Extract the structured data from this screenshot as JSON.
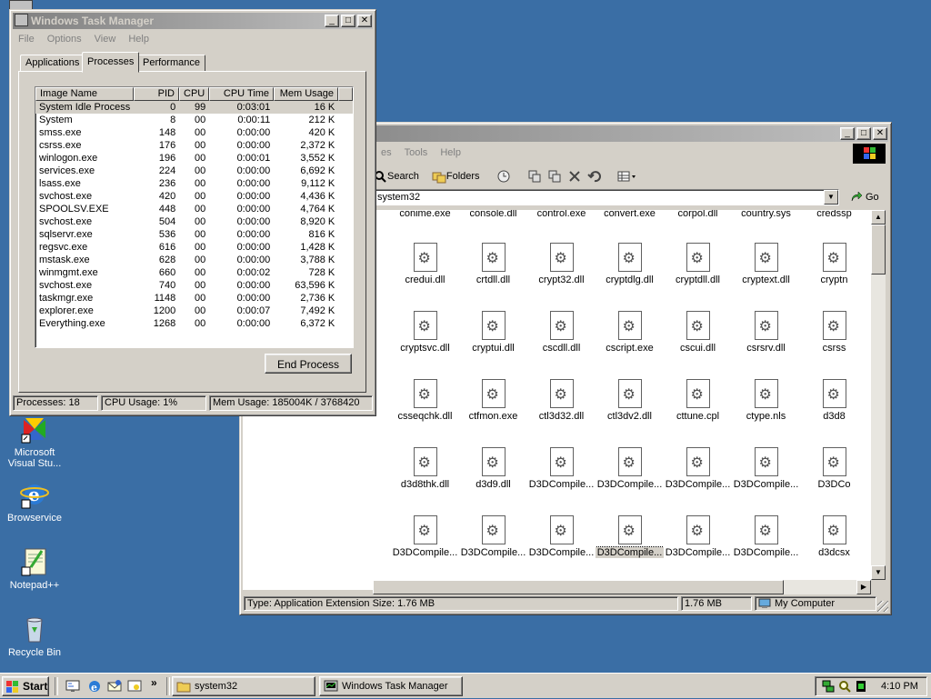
{
  "desktop": {
    "icons": [
      {
        "label": "Microsoft Visual Stu...",
        "icon": "visual-studio-icon"
      },
      {
        "label": "Browservice",
        "icon": "internet-explorer-icon"
      },
      {
        "label": "Notepad++",
        "icon": "notepad-icon"
      },
      {
        "label": "Recycle Bin",
        "icon": "recycle-bin-icon"
      }
    ]
  },
  "taskmgr": {
    "title": "Windows Task Manager",
    "menu": [
      "File",
      "Options",
      "View",
      "Help"
    ],
    "tabs": [
      "Applications",
      "Processes",
      "Performance"
    ],
    "active_tab": "Processes",
    "columns": [
      "Image Name",
      "PID",
      "CPU",
      "CPU Time",
      "Mem Usage"
    ],
    "rows": [
      [
        "System Idle Process",
        "0",
        "99",
        "0:03:01",
        "16 K"
      ],
      [
        "System",
        "8",
        "00",
        "0:00:11",
        "212 K"
      ],
      [
        "smss.exe",
        "148",
        "00",
        "0:00:00",
        "420 K"
      ],
      [
        "csrss.exe",
        "176",
        "00",
        "0:00:00",
        "2,372 K"
      ],
      [
        "winlogon.exe",
        "196",
        "00",
        "0:00:01",
        "3,552 K"
      ],
      [
        "services.exe",
        "224",
        "00",
        "0:00:00",
        "6,692 K"
      ],
      [
        "lsass.exe",
        "236",
        "00",
        "0:00:00",
        "9,112 K"
      ],
      [
        "svchost.exe",
        "420",
        "00",
        "0:00:00",
        "4,436 K"
      ],
      [
        "SPOOLSV.EXE",
        "448",
        "00",
        "0:00:00",
        "4,764 K"
      ],
      [
        "svchost.exe",
        "504",
        "00",
        "0:00:00",
        "8,920 K"
      ],
      [
        "sqlservr.exe",
        "536",
        "00",
        "0:00:00",
        "816 K"
      ],
      [
        "regsvc.exe",
        "616",
        "00",
        "0:00:00",
        "1,428 K"
      ],
      [
        "mstask.exe",
        "628",
        "00",
        "0:00:00",
        "3,788 K"
      ],
      [
        "winmgmt.exe",
        "660",
        "00",
        "0:00:02",
        "728 K"
      ],
      [
        "svchost.exe",
        "740",
        "00",
        "0:00:00",
        "63,596 K"
      ],
      [
        "taskmgr.exe",
        "1148",
        "00",
        "0:00:00",
        "2,736 K"
      ],
      [
        "explorer.exe",
        "1200",
        "00",
        "0:00:07",
        "7,492 K"
      ],
      [
        "Everything.exe",
        "1268",
        "00",
        "0:00:00",
        "6,372 K"
      ]
    ],
    "end_process_label": "End Process",
    "status": {
      "processes": "Processes: 18",
      "cpu": "CPU Usage: 1%",
      "mem": "Mem Usage: 185004K / 3768420"
    }
  },
  "explorer": {
    "title": "system32",
    "menu": [
      "es",
      "Tools",
      "Help"
    ],
    "toolbar": {
      "search": "Search",
      "folders": "Folders"
    },
    "address": "system32",
    "go_label": "Go",
    "top_row": [
      "conime.exe",
      "console.dll",
      "control.exe",
      "convert.exe",
      "corpol.dll",
      "country.sys",
      "credssp"
    ],
    "files": [
      [
        "credui.dll",
        "crtdll.dll",
        "crypt32.dll",
        "cryptdlg.dll",
        "cryptdll.dll",
        "cryptext.dll",
        "cryptn"
      ],
      [
        "cryptsvc.dll",
        "cryptui.dll",
        "cscdll.dll",
        "cscript.exe",
        "cscui.dll",
        "csrsrv.dll",
        "csrss"
      ],
      [
        "csseqchk.dll",
        "ctfmon.exe",
        "ctl3d32.dll",
        "ctl3dv2.dll",
        "cttune.cpl",
        "ctype.nls",
        "d3d8"
      ],
      [
        "d3d8thk.dll",
        "d3d9.dll",
        "D3DCompile...",
        "D3DCompile...",
        "D3DCompile...",
        "D3DCompile...",
        "D3DCo"
      ],
      [
        "D3DCompile...",
        "D3DCompile...",
        "D3DCompile...",
        "D3DCompile...",
        "D3DCompile...",
        "D3DCompile...",
        "d3dcsx"
      ]
    ],
    "status": {
      "type": "Type: Application Extension Size: 1.76 MB",
      "size": "1.76 MB",
      "zone": "My Computer"
    }
  },
  "taskbar": {
    "start": "Start",
    "tasks": [
      {
        "label": "system32",
        "icon": "folder-icon"
      },
      {
        "label": "Windows Task Manager",
        "icon": "task-manager-icon"
      }
    ],
    "clock": "4:10 PM"
  }
}
